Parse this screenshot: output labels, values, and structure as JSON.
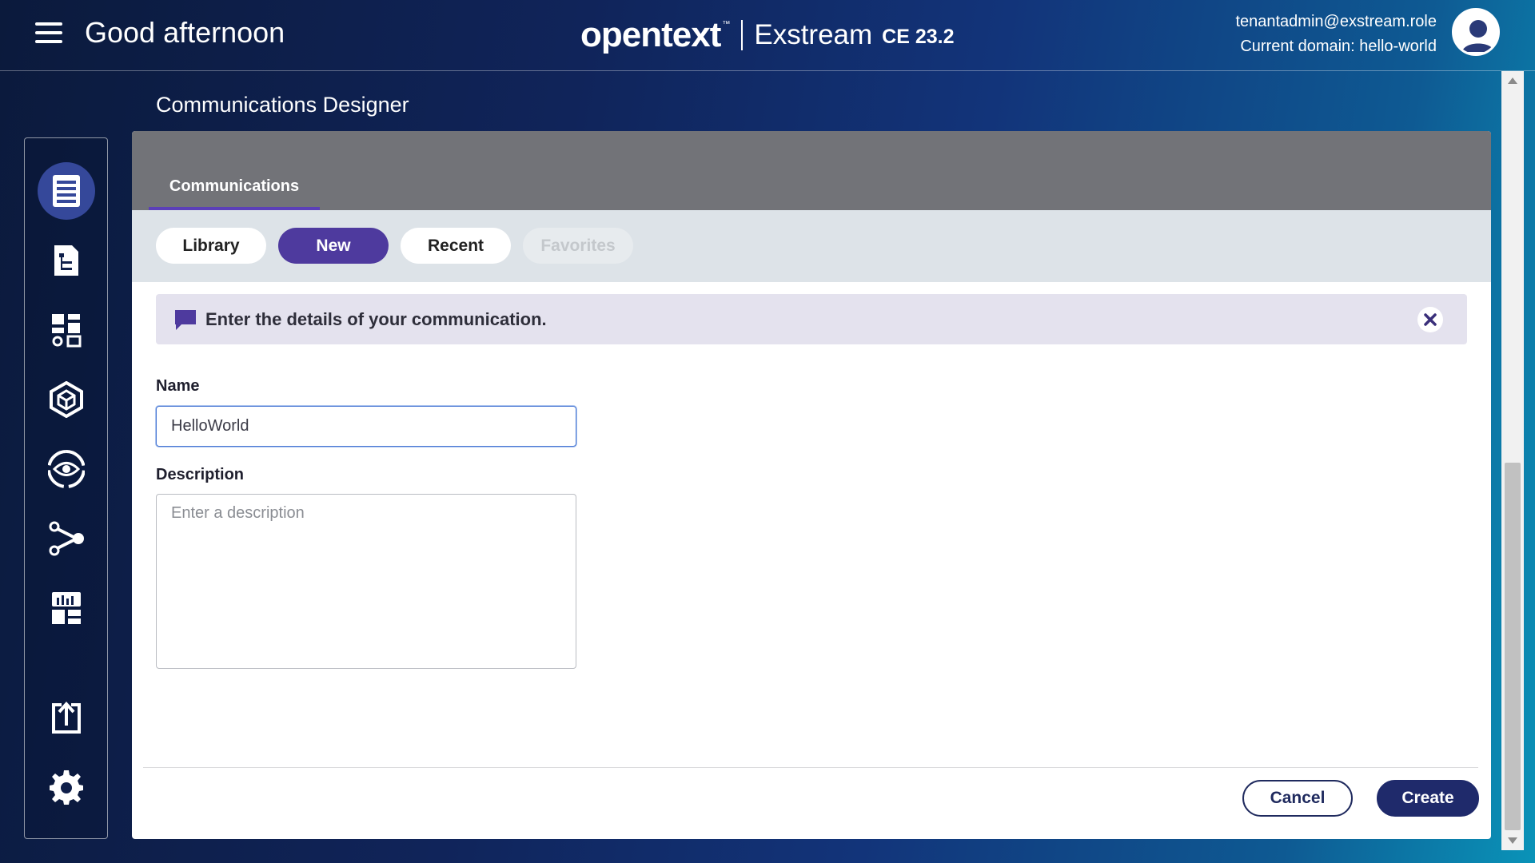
{
  "header": {
    "greeting": "Good afternoon",
    "brand_logo": "opentext",
    "brand_tm": "™",
    "product": "Exstream",
    "version": "CE 23.2",
    "user_email": "tenantadmin@exstream.role",
    "current_domain": "Current domain: hello-world"
  },
  "sidebar": {
    "items": [
      {
        "icon": "communications-designer-icon",
        "active": true
      },
      {
        "icon": "document-tree-icon",
        "active": false
      },
      {
        "icon": "dashboard-settings-icon",
        "active": false
      },
      {
        "icon": "package-cube-icon",
        "active": false
      },
      {
        "icon": "eye-review-icon",
        "active": false
      },
      {
        "icon": "workflow-share-icon",
        "active": false
      },
      {
        "icon": "reports-grid-icon",
        "active": false
      },
      {
        "icon": "export-upload-icon",
        "active": false
      },
      {
        "icon": "gear-icon",
        "active": false
      }
    ]
  },
  "page": {
    "title": "Communications Designer"
  },
  "panel": {
    "tab": "Communications",
    "subtabs": {
      "library": "Library",
      "new": "New",
      "recent": "Recent",
      "favorites": "Favorites"
    },
    "info_message": "Enter the details of your communication.",
    "name_label": "Name",
    "name_value": "HelloWorld",
    "description_label": "Description",
    "description_placeholder": "Enter a description",
    "cancel_label": "Cancel",
    "create_label": "Create"
  },
  "colors": {
    "accent": "#4e3a9e",
    "primary_button": "#1f2a6b",
    "panel_header": "#727378",
    "subtab_bar": "#dde3e8",
    "info_bar": "#e4e2ee"
  }
}
